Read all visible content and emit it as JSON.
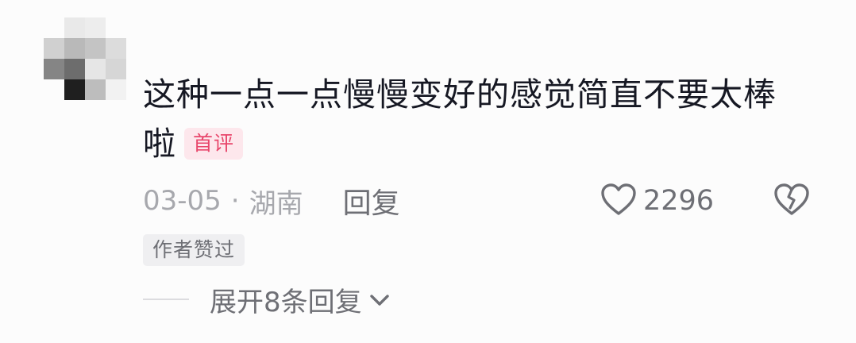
{
  "comment": {
    "text": "这种一点一点慢慢变好的感觉简直不要太棒啦",
    "badge": "首评",
    "date": "03-05",
    "separator": "·",
    "location": "湖南",
    "reply_label": "回复",
    "like_count": "2296",
    "author_liked_label": "作者赞过",
    "expand_replies_label": "展开8条回复"
  },
  "avatar": {
    "style": "pixelated-mosaic",
    "tiles": [
      "#fcfcfc",
      "#e9e9e9",
      "#ededed",
      "#fcfcfc",
      "#d0d0d0",
      "#b9b9b9",
      "#c4c4c4",
      "#dcdcdc",
      "#858585",
      "#6d6d6d",
      "#e6e6e6",
      "#d6d6d6",
      "#fcfcfc",
      "#1f1f1f",
      "#bdbdbd",
      "#f2f2f2"
    ]
  },
  "icons": {
    "like": "heart-outline-icon",
    "dislike": "broken-heart-icon",
    "expand": "chevron-down-icon"
  },
  "colors": {
    "text_primary": "#161823",
    "text_secondary": "#6e6f75",
    "text_muted": "#a7a8ad",
    "badge_text": "#e8466b",
    "badge_bg": "#fde7ec",
    "author_tag_bg": "#efeff1"
  }
}
